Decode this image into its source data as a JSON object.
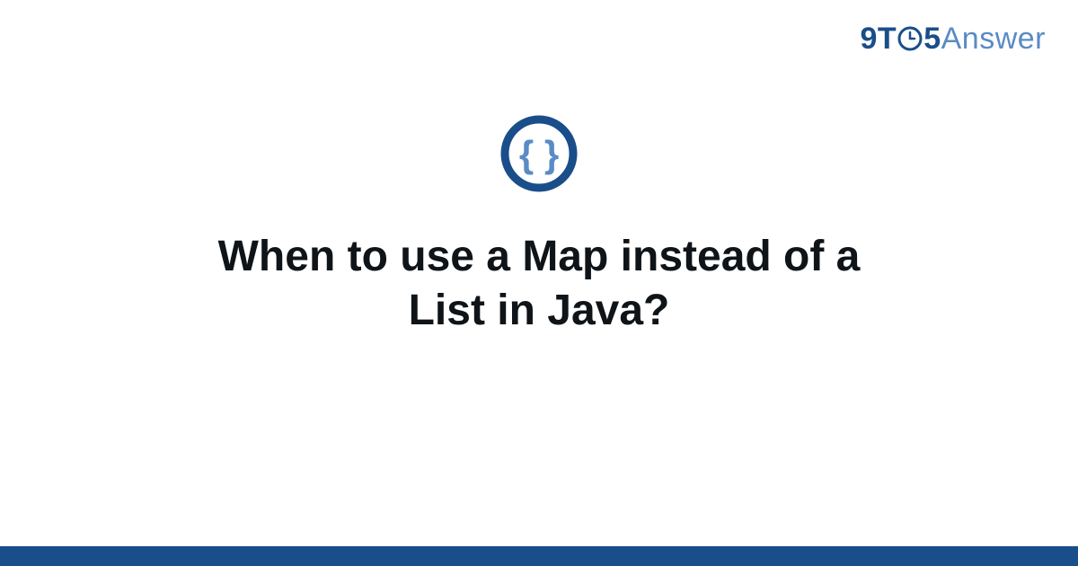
{
  "brand": {
    "part1": "9",
    "part2": "T",
    "part3": "5",
    "part4": "Answer"
  },
  "heading": "When to use a Map instead of a List in Java?",
  "colors": {
    "brand_dark": "#1a4e8a",
    "brand_light": "#5a8bc4"
  }
}
